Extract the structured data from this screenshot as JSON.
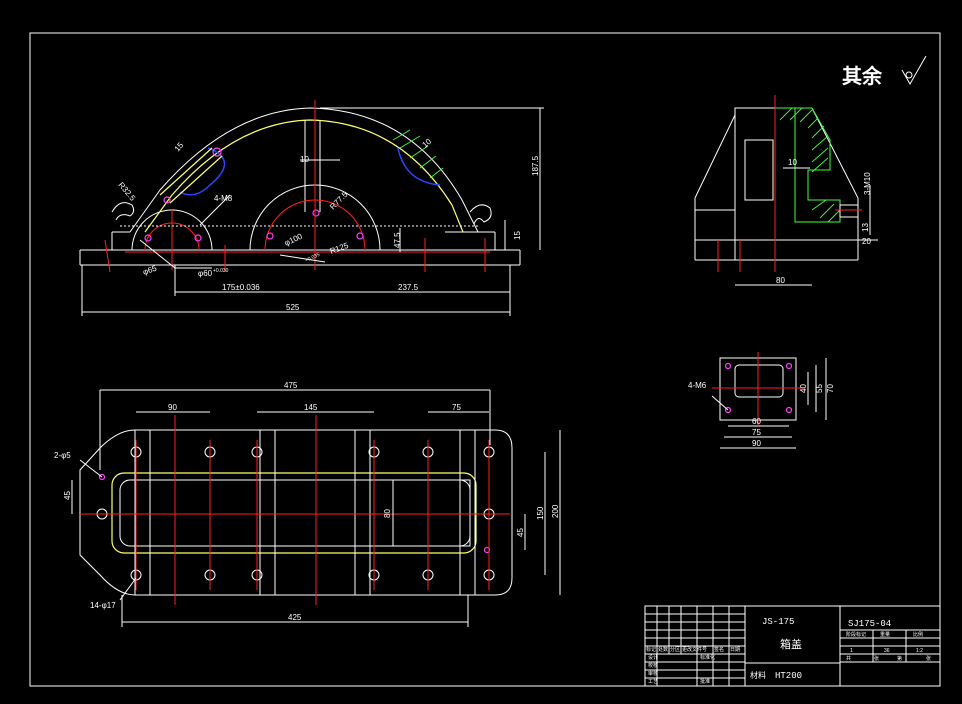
{
  "surface_note": {
    "label": "其余"
  },
  "front_view": {
    "dims": {
      "d10": "10",
      "d15a": "15",
      "r325": "R32.5",
      "m8": "4-M8",
      "d10b": "10",
      "r775": "R77.5",
      "h1875": "187.5",
      "h15": "15",
      "h475": "47.5",
      "phi65": "φ65",
      "phi60": "φ60",
      "tol60": "+0.030",
      "phi100": "φ100",
      "tol100": "+0.035",
      "r125": "R125",
      "c175": "175±0.036",
      "c2375": "237.5",
      "w525": "525"
    }
  },
  "side_view": {
    "dims": {
      "d10": "10",
      "m10": "3-M10",
      "d13": "13",
      "d20": "20",
      "w80": "80"
    }
  },
  "cover_view": {
    "dims": {
      "m6": "4-M6",
      "d60": "60",
      "d75": "75",
      "d90": "90",
      "d40": "40",
      "d55": "55",
      "d70": "70"
    }
  },
  "plan_view": {
    "dims": {
      "w475": "475",
      "d90": "90",
      "d145": "145",
      "d75": "75",
      "h2phi5": "2-φ5",
      "d45": "45",
      "d80": "80",
      "d45b": "45",
      "d150": "150",
      "d200": "200",
      "h14phi17": "14-φ17",
      "w425": "425"
    }
  },
  "title_block": {
    "project": "JS-175",
    "drawing_no": "SJ175-04",
    "part_name": "箱盖",
    "material_label": "材料",
    "material": "HT200",
    "hdr_mark": "标记",
    "hdr_count": "处数",
    "hdr_zone": "分区",
    "hdr_change": "更改文件号",
    "hdr_sign": "签名",
    "hdr_date": "日期",
    "row_design": "设计",
    "row_std": "标准化",
    "row_check": "审核",
    "row_craft": "工艺",
    "row_approve": "批准",
    "row_review": "校核",
    "col_stage": "阶段标记",
    "col_weight": "重量",
    "col_scale": "比例",
    "scale": "1:2",
    "stage_val": "1",
    "weight_val": "36",
    "sheet_total": "共",
    "sheet_label": "张",
    "sheet_no": "第",
    "sheet_label2": "张"
  },
  "colors": {
    "outline": "#ffffff",
    "centerline": "#ff2020",
    "inner": "#ffff66",
    "dims": "#00c8ff",
    "hatch": "#3cff3c"
  }
}
